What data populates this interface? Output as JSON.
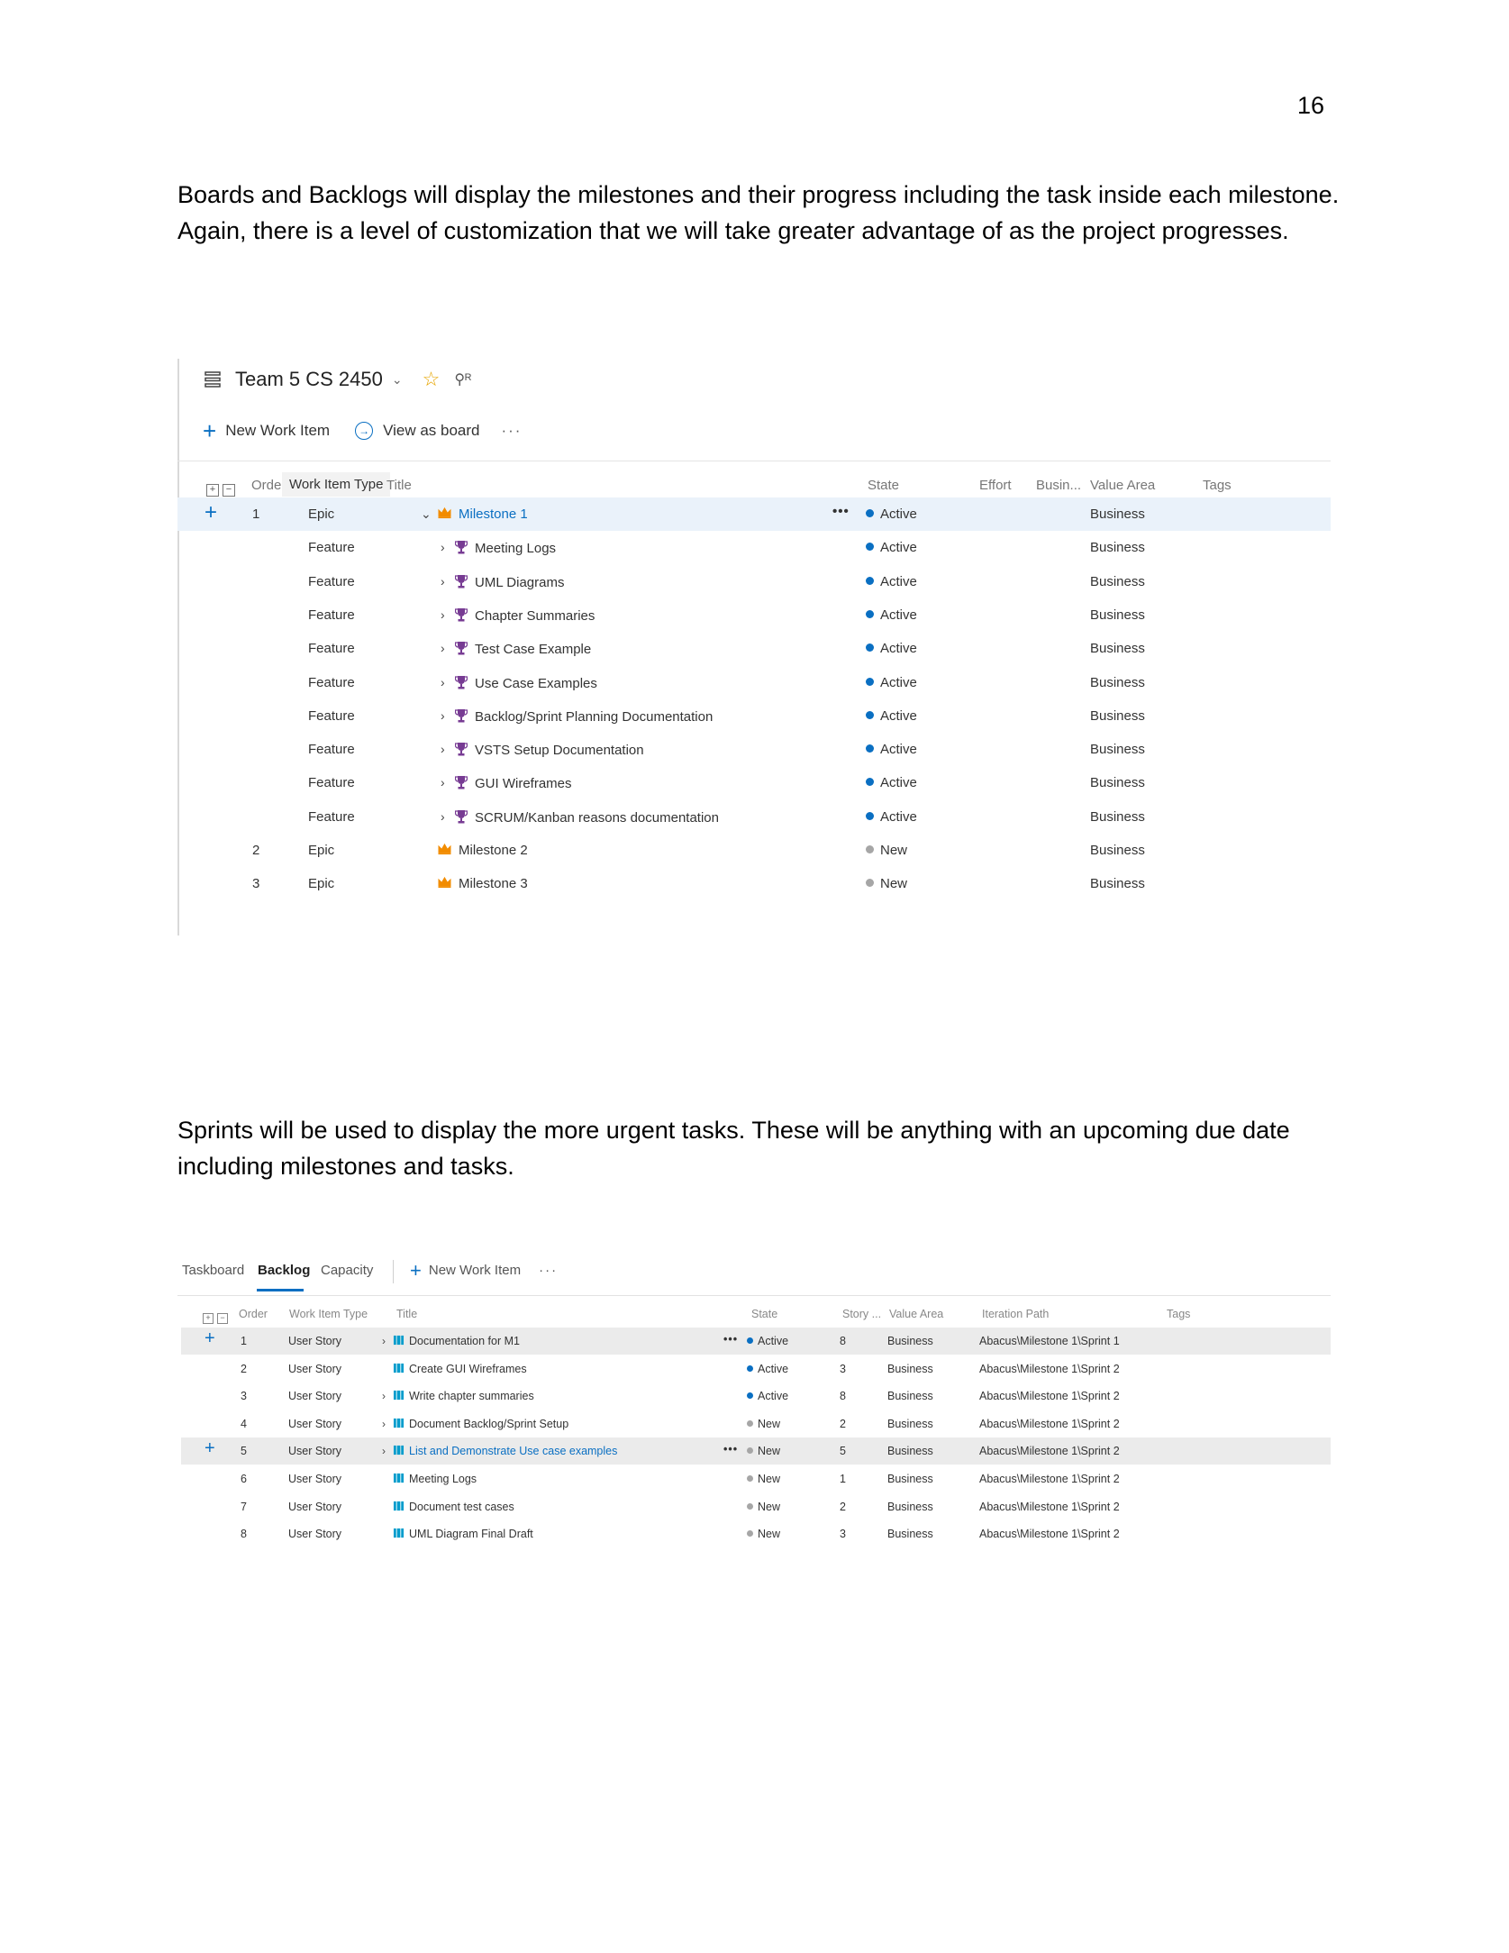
{
  "page": {
    "number": "16",
    "paragraph1": "Boards and Backlogs will display the milestones and their progress including the task inside each milestone. Again, there is a level of customization that we will take greater advantage of as the project progresses.",
    "paragraph2": "Sprints will be used to display the more urgent tasks. These will be anything with an upcoming due date including milestones and tasks."
  },
  "colors": {
    "accent": "#0a6fc2",
    "active_dot": "#0a6fc2",
    "new_dot": "#a6a6a6",
    "epic_icon": "#f28c00",
    "feature_icon": "#773b93",
    "story_icon": "#009ccc"
  },
  "backlog": {
    "team_name": "Team 5 CS 2450",
    "new_work_item": "New Work Item",
    "view_as_board": "View as board",
    "more": "···",
    "columns": {
      "order": "Order",
      "type": "Work Item Type",
      "title": "Title",
      "state": "State",
      "effort": "Effort",
      "business": "Busin...",
      "value_area": "Value Area",
      "tags": "Tags"
    },
    "rows": [
      {
        "order": "1",
        "type": "Epic",
        "title": "Milestone 1",
        "state": "Active",
        "value_area": "Business",
        "kind": "epic"
      },
      {
        "order": "",
        "type": "Feature",
        "title": "Meeting Logs",
        "state": "Active",
        "value_area": "Business",
        "kind": "feature"
      },
      {
        "order": "",
        "type": "Feature",
        "title": "UML Diagrams",
        "state": "Active",
        "value_area": "Business",
        "kind": "feature"
      },
      {
        "order": "",
        "type": "Feature",
        "title": "Chapter Summaries",
        "state": "Active",
        "value_area": "Business",
        "kind": "feature"
      },
      {
        "order": "",
        "type": "Feature",
        "title": "Test Case Example",
        "state": "Active",
        "value_area": "Business",
        "kind": "feature"
      },
      {
        "order": "",
        "type": "Feature",
        "title": "Use Case Examples",
        "state": "Active",
        "value_area": "Business",
        "kind": "feature"
      },
      {
        "order": "",
        "type": "Feature",
        "title": "Backlog/Sprint Planning Documentation",
        "state": "Active",
        "value_area": "Business",
        "kind": "feature"
      },
      {
        "order": "",
        "type": "Feature",
        "title": "VSTS Setup Documentation",
        "state": "Active",
        "value_area": "Business",
        "kind": "feature"
      },
      {
        "order": "",
        "type": "Feature",
        "title": "GUI Wireframes",
        "state": "Active",
        "value_area": "Business",
        "kind": "feature"
      },
      {
        "order": "",
        "type": "Feature",
        "title": "SCRUM/Kanban reasons documentation",
        "state": "Active",
        "value_area": "Business",
        "kind": "feature"
      },
      {
        "order": "2",
        "type": "Epic",
        "title": "Milestone 2",
        "state": "New",
        "value_area": "Business",
        "kind": "epic"
      },
      {
        "order": "3",
        "type": "Epic",
        "title": "Milestone 3",
        "state": "New",
        "value_area": "Business",
        "kind": "epic"
      }
    ]
  },
  "sprint": {
    "tabs": [
      "Taskboard",
      "Backlog",
      "Capacity"
    ],
    "new_work_item": "New Work Item",
    "more": "···",
    "columns": {
      "order": "Order",
      "type": "Work Item Type",
      "title": "Title",
      "state": "State",
      "story": "Story ...",
      "value_area": "Value Area",
      "iteration": "Iteration Path",
      "tags": "Tags"
    },
    "rows": [
      {
        "order": "1",
        "type": "User Story",
        "title": "Documentation for M1",
        "state": "Active",
        "story": "8",
        "value_area": "Business",
        "iteration": "Abacus\\Milestone 1\\Sprint 1"
      },
      {
        "order": "2",
        "type": "User Story",
        "title": "Create GUI Wireframes",
        "state": "Active",
        "story": "3",
        "value_area": "Business",
        "iteration": "Abacus\\Milestone 1\\Sprint 2"
      },
      {
        "order": "3",
        "type": "User Story",
        "title": "Write chapter summaries",
        "state": "Active",
        "story": "8",
        "value_area": "Business",
        "iteration": "Abacus\\Milestone 1\\Sprint 2"
      },
      {
        "order": "4",
        "type": "User Story",
        "title": "Document Backlog/Sprint Setup",
        "state": "New",
        "story": "2",
        "value_area": "Business",
        "iteration": "Abacus\\Milestone 1\\Sprint 2"
      },
      {
        "order": "5",
        "type": "User Story",
        "title": "List and Demonstrate Use case examples",
        "state": "New",
        "story": "5",
        "value_area": "Business",
        "iteration": "Abacus\\Milestone 1\\Sprint 2"
      },
      {
        "order": "6",
        "type": "User Story",
        "title": "Meeting Logs",
        "state": "New",
        "story": "1",
        "value_area": "Business",
        "iteration": "Abacus\\Milestone 1\\Sprint 2"
      },
      {
        "order": "7",
        "type": "User Story",
        "title": "Document test cases",
        "state": "New",
        "story": "2",
        "value_area": "Business",
        "iteration": "Abacus\\Milestone 1\\Sprint 2"
      },
      {
        "order": "8",
        "type": "User Story",
        "title": "UML Diagram Final Draft",
        "state": "New",
        "story": "3",
        "value_area": "Business",
        "iteration": "Abacus\\Milestone 1\\Sprint 2"
      }
    ]
  }
}
